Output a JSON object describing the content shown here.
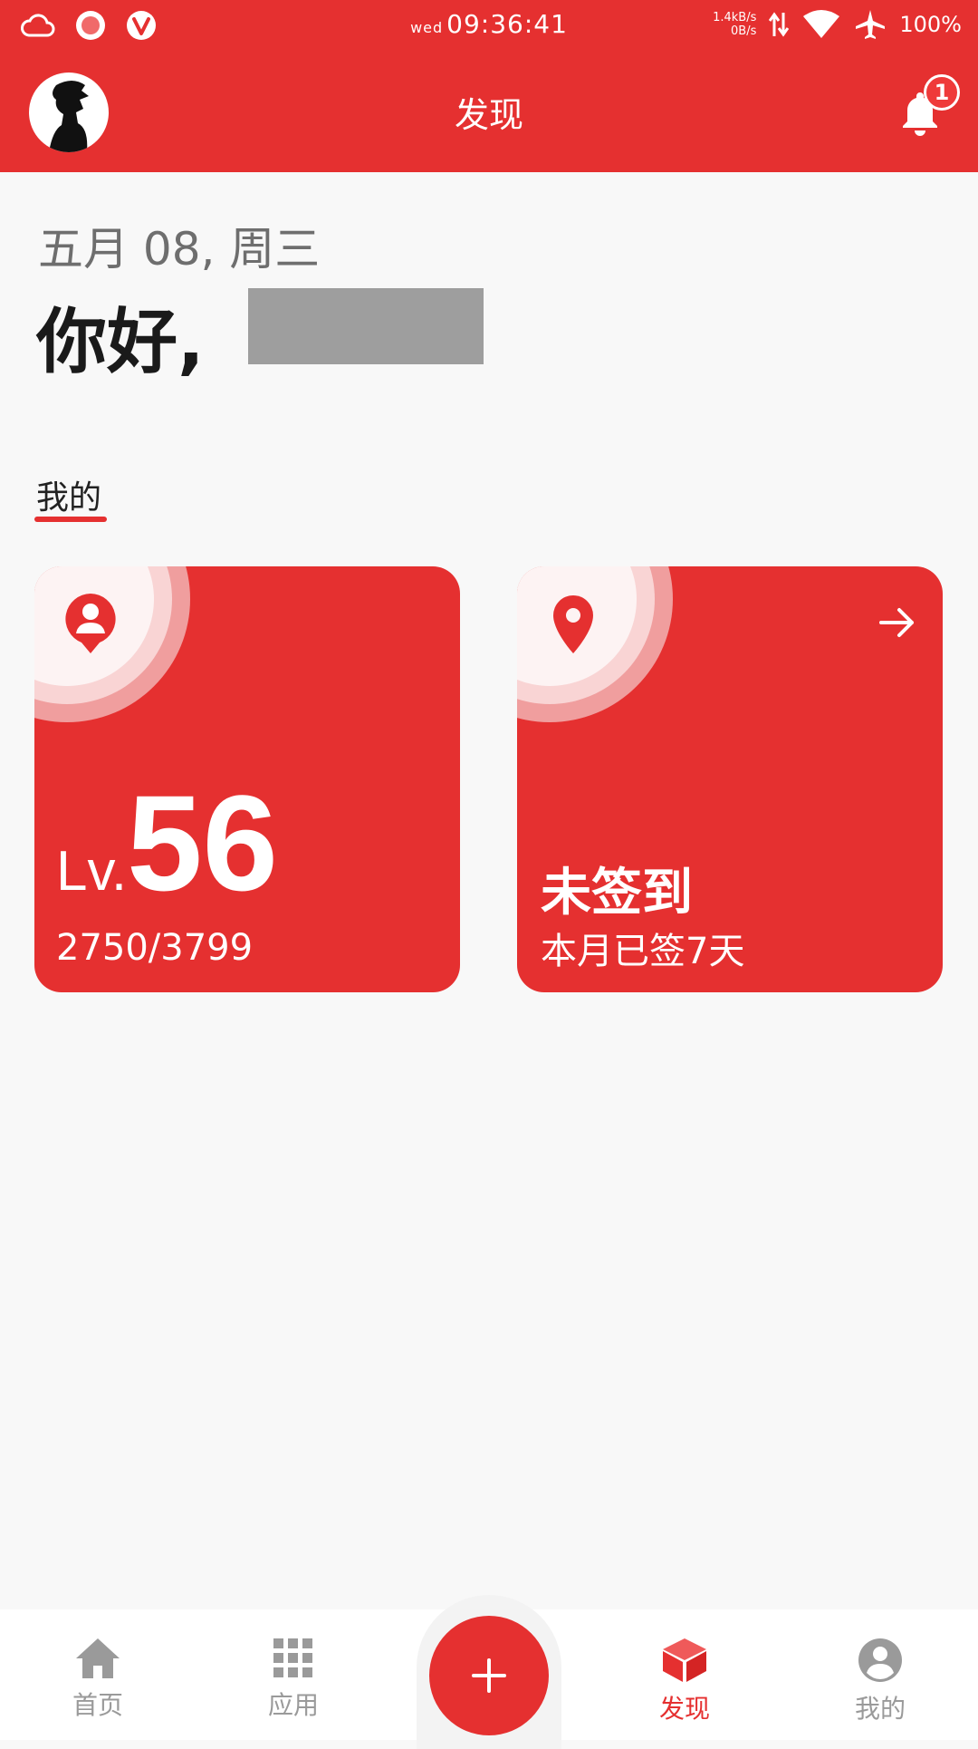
{
  "status_bar": {
    "day": "wed",
    "time": "09:36:41",
    "net_up": "1.4kB/s",
    "net_down": "0B/s",
    "battery": "100%"
  },
  "app_bar": {
    "title": "发现",
    "notification_count": "1"
  },
  "greeting": {
    "date": "五月 08, 周三",
    "hello": "你好,"
  },
  "section": {
    "title": "我的"
  },
  "cards": {
    "level": {
      "prefix": "Lv.",
      "value": "56",
      "exp": "2750/3799"
    },
    "checkin": {
      "status": "未签到",
      "summary": "本月已签7天"
    }
  },
  "bottom_nav": {
    "items": [
      {
        "label": "首页"
      },
      {
        "label": "应用"
      },
      {
        "label": "+"
      },
      {
        "label": "发现"
      },
      {
        "label": "我的"
      }
    ]
  },
  "colors": {
    "brand": "#e53030",
    "inactive": "#9a9a9a"
  }
}
